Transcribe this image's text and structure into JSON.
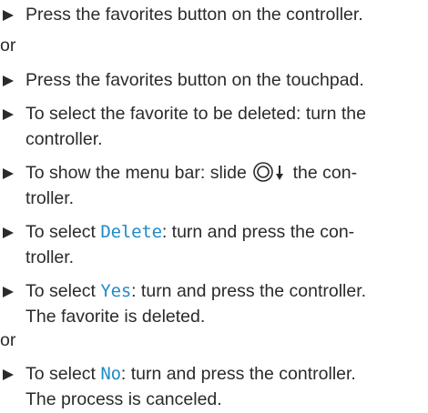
{
  "steps": {
    "s1": {
      "text": "Press the favorites button on the controller."
    },
    "or1": "or",
    "s2": {
      "text": "Press the favorites button on the touchpad."
    },
    "s3": {
      "line1": "To select the favorite to be deleted: turn the",
      "line2": "controller."
    },
    "s4": {
      "before": "To show the menu bar: slide",
      "after": "the con-",
      "line2": "troller.",
      "icon": "controller-slide-down-icon"
    },
    "s5": {
      "before": "To select",
      "term": "Delete",
      "after": ": turn and press the con-",
      "line2": "troller."
    },
    "s6": {
      "before": "To select",
      "term": "Yes",
      "after": ": turn and press the controller.",
      "line2": "The favorite is deleted."
    },
    "or2": "or",
    "s7": {
      "before": "To select",
      "term": "No",
      "after": ": turn and press the controller.",
      "line2": "The process is canceled."
    }
  },
  "colors": {
    "text": "#2b2b2b",
    "ui_term": "#1f8bc9"
  },
  "icons": {
    "bullet": "triangle-right-icon"
  }
}
